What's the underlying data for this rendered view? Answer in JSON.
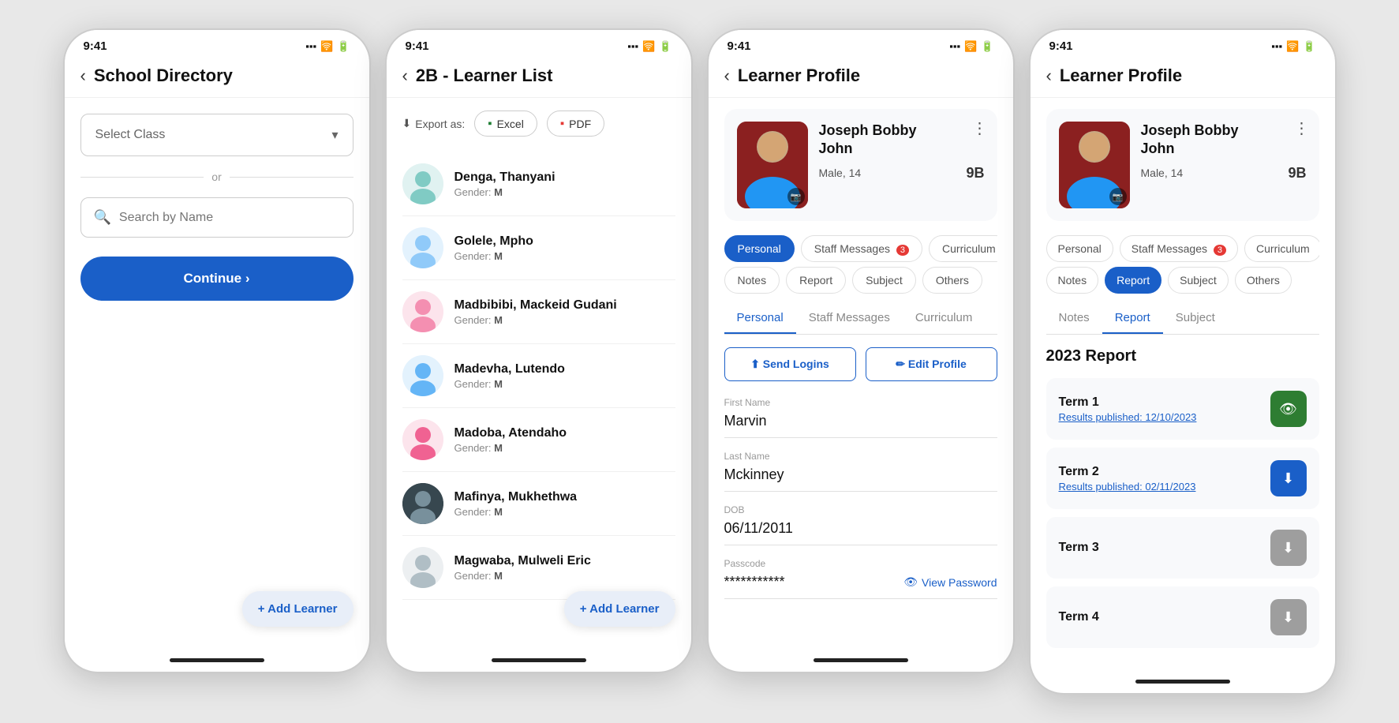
{
  "screens": [
    {
      "id": "school-directory",
      "status_time": "9:41",
      "header": {
        "back_label": "‹",
        "title": "School Directory"
      },
      "select_class_placeholder": "Select Class",
      "divider_text": "or",
      "search_placeholder": "Search by Name",
      "continue_label": "Continue  ›",
      "add_learner_label": "+ Add Learner"
    },
    {
      "id": "learner-list",
      "status_time": "9:41",
      "header": {
        "back_label": "‹",
        "title": "2B - Learner List"
      },
      "export_label": "Export as:",
      "export_excel": "Excel",
      "export_pdf": "PDF",
      "learners": [
        {
          "name": "Denga, Thanyani",
          "gender": "M",
          "avatar_color": "teal",
          "avatar_emoji": "👩"
        },
        {
          "name": "Golele, Mpho",
          "gender": "M",
          "avatar_color": "blue",
          "avatar_emoji": "👩‍🦱"
        },
        {
          "name": "Madbibibi, Mackeid Gudani",
          "gender": "M",
          "avatar_color": "pink",
          "avatar_emoji": "👨"
        },
        {
          "name": "Madevha, Lutendo",
          "gender": "M",
          "avatar_color": "blue",
          "avatar_emoji": "👦"
        },
        {
          "name": "Madoba, Atendaho",
          "gender": "M",
          "avatar_color": "pink",
          "avatar_emoji": "👩"
        },
        {
          "name": "Mafinya, Mukhethwa",
          "gender": "M",
          "avatar_color": "dark",
          "avatar_emoji": "👩‍🦱"
        },
        {
          "name": "Magwaba, Mulweli Eric",
          "gender": "M",
          "avatar_color": "gray",
          "avatar_emoji": "👨‍🦳"
        }
      ],
      "add_learner_label": "+ Add Learner"
    },
    {
      "id": "learner-profile-personal",
      "status_time": "9:41",
      "header": {
        "back_label": "‹",
        "title": "Learner Profile"
      },
      "student": {
        "name": "Joseph Bobby\nJohn",
        "name_line1": "Joseph Bobby",
        "name_line2": "John",
        "gender": "Male, 14",
        "grade": "9B"
      },
      "tabs_pills": [
        {
          "label": "Personal",
          "active": true,
          "badge": null
        },
        {
          "label": "Staff Messages",
          "active": false,
          "badge": "3"
        },
        {
          "label": "Curriculum",
          "active": false,
          "badge": null
        },
        {
          "label": "Notes",
          "active": false,
          "badge": null
        },
        {
          "label": "Report",
          "active": false,
          "badge": null
        },
        {
          "label": "Subject",
          "active": false,
          "badge": null
        },
        {
          "label": "Others",
          "active": false,
          "badge": null
        }
      ],
      "tabs_underline": [
        {
          "label": "Personal",
          "active": true
        },
        {
          "label": "Staff Messages",
          "active": false
        },
        {
          "label": "Curriculum",
          "active": false
        }
      ],
      "tabs_underline2": [
        {
          "label": "Notes",
          "active": false
        },
        {
          "label": "Report",
          "active": false
        },
        {
          "label": "Subject",
          "active": false
        },
        {
          "label": "Others",
          "active": false
        }
      ],
      "send_logins_label": "⬆ Send Logins",
      "edit_profile_label": "✏ Edit Profile",
      "fields": [
        {
          "label": "First Name",
          "value": "Marvin"
        },
        {
          "label": "Last Name",
          "value": "Mckinney"
        },
        {
          "label": "DOB",
          "value": "06/11/2011"
        },
        {
          "label": "Passcode",
          "value": "***********"
        }
      ],
      "view_password_label": "View Password"
    },
    {
      "id": "learner-profile-report",
      "status_time": "9:41",
      "header": {
        "back_label": "‹",
        "title": "Learner Profile"
      },
      "student": {
        "name_line1": "Joseph Bobby",
        "name_line2": "John",
        "gender": "Male, 14",
        "grade": "9B"
      },
      "tabs_pills": [
        {
          "label": "Personal",
          "active": false,
          "badge": null
        },
        {
          "label": "Staff Messages",
          "active": false,
          "badge": "3"
        },
        {
          "label": "Curriculum",
          "active": false,
          "badge": null
        },
        {
          "label": "Notes",
          "active": false,
          "badge": null
        },
        {
          "label": "Report",
          "active": true,
          "badge": null
        },
        {
          "label": "Subject",
          "active": false,
          "badge": null
        },
        {
          "label": "Others",
          "active": false,
          "badge": null
        }
      ],
      "tabs_underline": [
        {
          "label": "Notes",
          "active": false
        },
        {
          "label": "Report",
          "active": true
        },
        {
          "label": "Subject",
          "active": false
        }
      ],
      "report_year": "2023 Report",
      "terms": [
        {
          "name": "Term 1",
          "published": "Results published: 12/10/2023",
          "btn_type": "green",
          "icon": "👁"
        },
        {
          "name": "Term 2",
          "published": "Results published: 02/11/2023",
          "btn_type": "blue",
          "icon": "⬇"
        },
        {
          "name": "Term 3",
          "published": null,
          "btn_type": "gray",
          "icon": "⬇"
        },
        {
          "name": "Term 4",
          "published": null,
          "btn_type": "gray",
          "icon": "⬇"
        }
      ]
    }
  ]
}
